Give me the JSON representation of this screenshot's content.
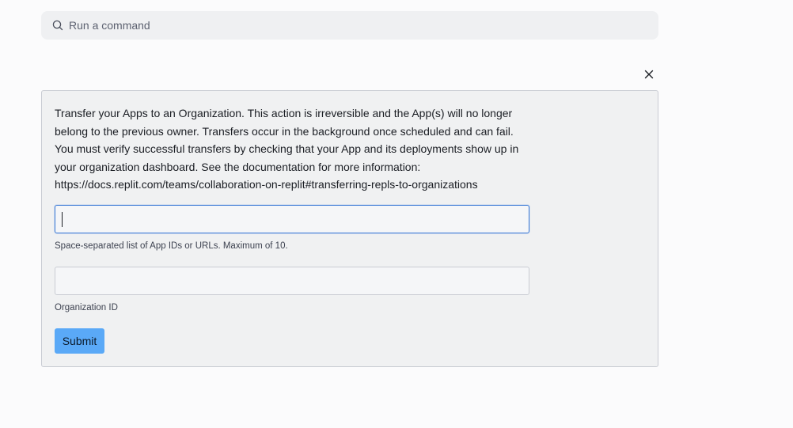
{
  "command_bar": {
    "placeholder": "Run a command",
    "icon": "search-icon"
  },
  "dialog": {
    "close_icon": "close-icon",
    "description_lines": [
      "Transfer your Apps to an Organization. This action is irreversible and the App(s) will no longer",
      "belong to the previous owner. Transfers occur in the background once scheduled and can fail.",
      "You must verify successful transfers by checking that your App and its deployments show up in",
      "your organization dashboard. See the documentation for more information:",
      "https://docs.replit.com/teams/collaboration-on-replit#transferring-repls-to-organizations"
    ],
    "app_ids_field": {
      "value": "",
      "help": "Space-separated list of App IDs or URLs. Maximum of 10."
    },
    "org_id_field": {
      "value": "",
      "help": "Organization ID"
    },
    "submit_label": "Submit"
  },
  "colors": {
    "background": "#fbfbfc",
    "panel": "#f0f1f2",
    "focus_border": "#3c7ad6",
    "submit": "#5aa9f7"
  }
}
